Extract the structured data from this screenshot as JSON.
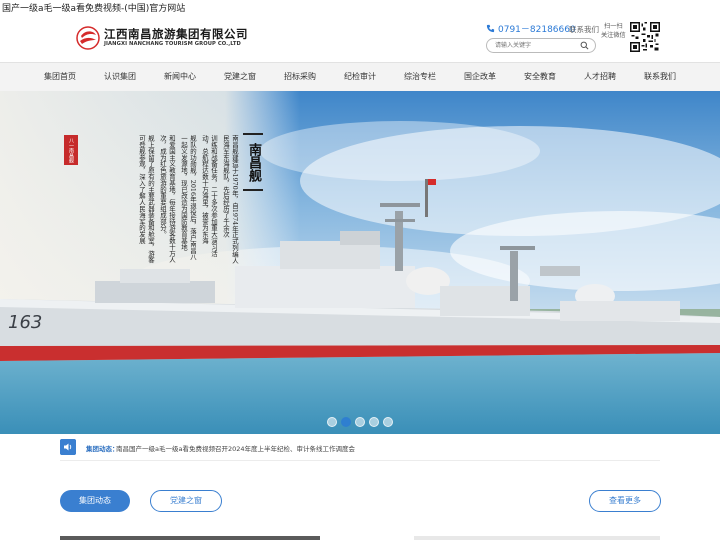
{
  "site_title": "国产一级a毛一级a看免费视频-(中国)官方网站",
  "logo": {
    "name_cn": "江西南昌旅游集团有限公司",
    "name_en": "JIANGXI NANCHANG TOURISM GROUP CO.,LTD",
    "brand_color": "#d52b2b"
  },
  "header": {
    "phone": "0791－82186660",
    "contact_label": "联系我们",
    "search_placeholder": "请输入关键字",
    "scan_line1": "扫一扫",
    "scan_line2": "关注微信"
  },
  "nav": {
    "items": [
      {
        "label": "集团首页"
      },
      {
        "label": "认识集团"
      },
      {
        "label": "新闻中心"
      },
      {
        "label": "党建之窗"
      },
      {
        "label": "招标采购"
      },
      {
        "label": "纪检审计"
      },
      {
        "label": "综治专栏"
      },
      {
        "label": "国企改革"
      },
      {
        "label": "安全教育"
      },
      {
        "label": "人才招聘"
      },
      {
        "label": "联系我们"
      }
    ]
  },
  "banner": {
    "seal_text": "八一南昌舰",
    "ship_title": "南昌舰",
    "hull_number": "163",
    "text_columns": [
      "南昌舰建造于1970年，自1974年正式列编人民海军东海舰队，先后经历了千余次",
      "训练和战备任务，二十多次参加重大演习活动，总航程达数十万海里，被誉为东海",
      "舰队的功勋舰，2016年退役后，落户南昌八一起义发源地，现已改造为国防教育基地",
      "和爱国主义教育基地，每年接待游客数十万人次，成为红色旅游的重要组成部分。",
      "舰上保留了原有的主要武器装备和舱室，游客可登舰参观，深入了解人民海军的发展"
    ],
    "slide_count": 5,
    "active_slide": 2
  },
  "ticker": {
    "label": "集团动态：",
    "text": "南昌国产一级a毛一级a看免费视频召开2024年度上半年纪检、审计条线工作调度会"
  },
  "section_tabs": {
    "primary": "集团动态",
    "secondary": "党建之窗",
    "more": "查看更多"
  },
  "colors": {
    "accent": "#3a7fd0",
    "nav_bg": "#f3f3f3",
    "stripe_red": "#c92f2f"
  }
}
